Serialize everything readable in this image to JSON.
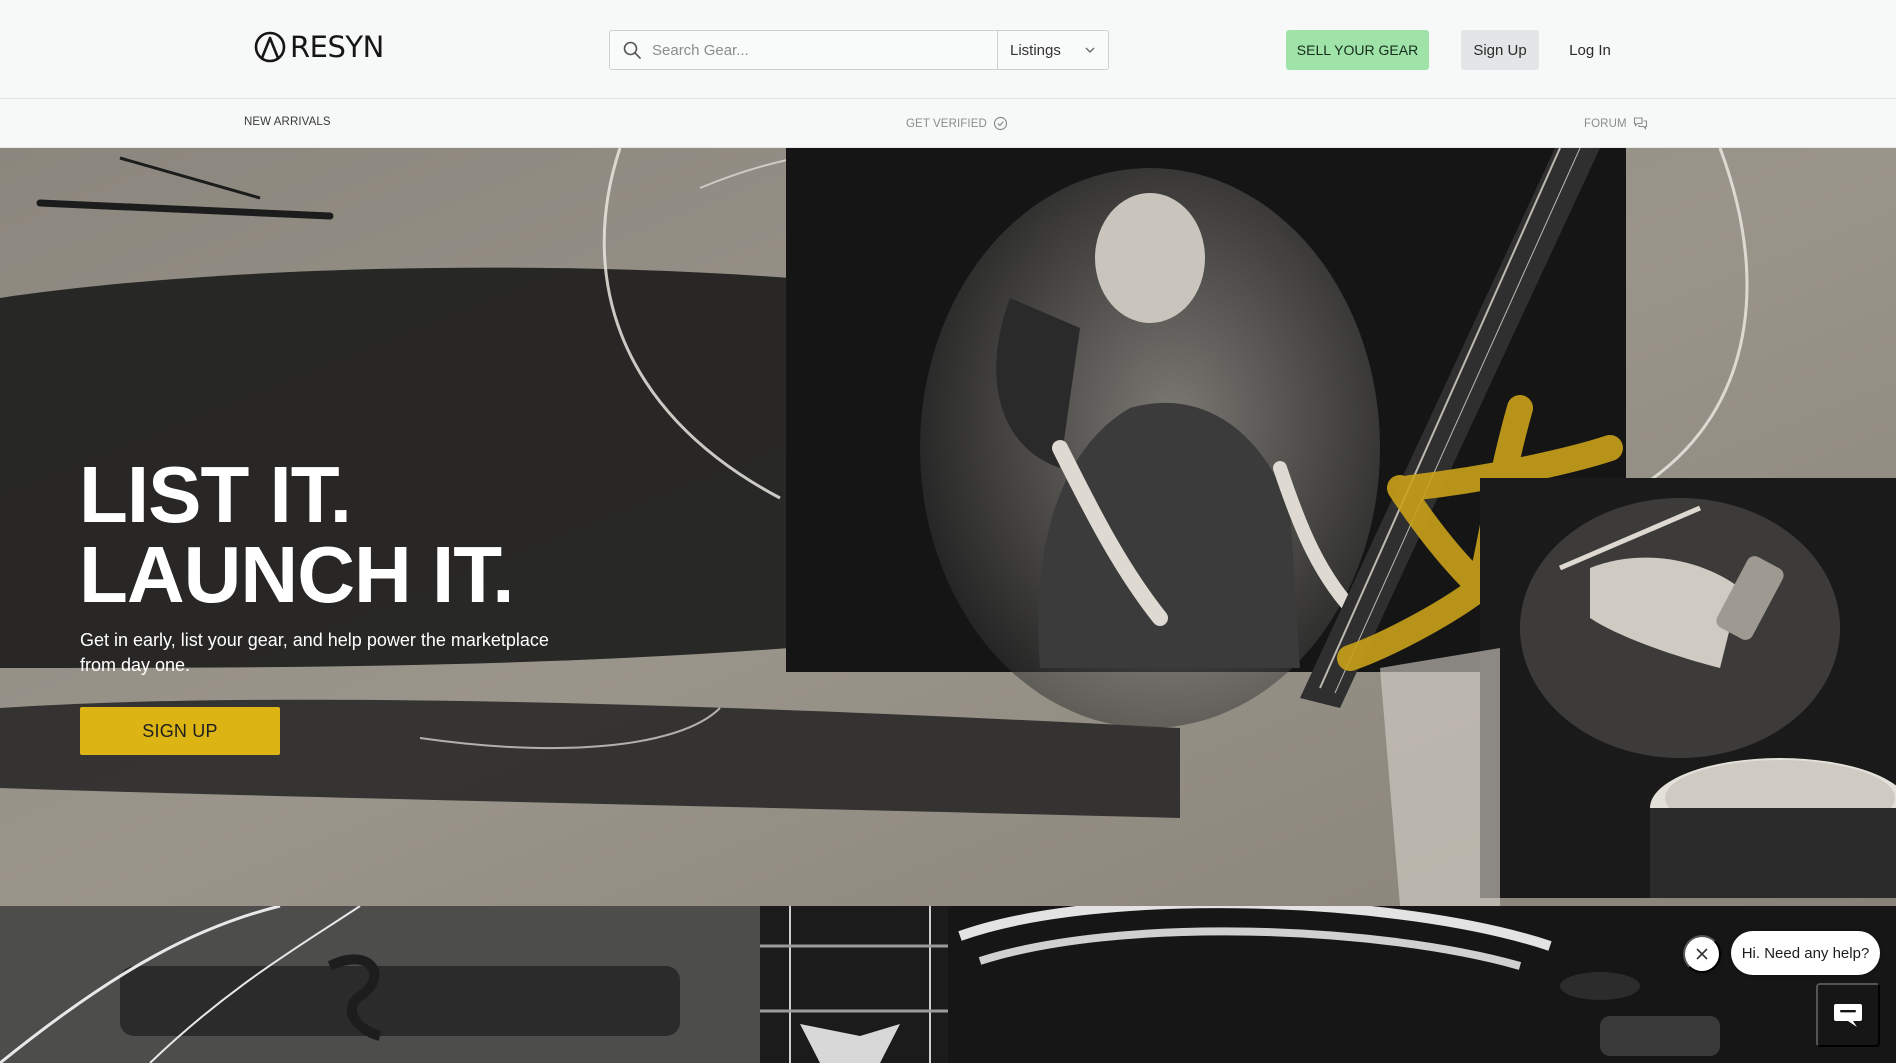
{
  "header": {
    "logo_text": "RESYN",
    "search": {
      "placeholder": "Search Gear...",
      "value": ""
    },
    "listings_select": {
      "selected": "Listings"
    },
    "sell_button": "SELL YOUR GEAR",
    "signup_button": "Sign Up",
    "login_link": "Log In"
  },
  "subnav": {
    "new_arrivals": "NEW ARRIVALS",
    "get_verified": "GET VERIFIED",
    "forum": "FORUM"
  },
  "hero": {
    "title_line1": "LIST IT.",
    "title_line2": "LAUNCH IT.",
    "subtitle": "Get in early, list your gear, and help power the marketplace from day one.",
    "cta": "SIGN UP"
  },
  "help_widget": {
    "message": "Hi. Need any help?"
  },
  "colors": {
    "accent_green": "#9fe3a9",
    "cta_yellow": "#dcb414",
    "hero_bg": "#8e8a82"
  },
  "icons": [
    "logo-mark-icon",
    "search-icon",
    "chevron-down-icon",
    "check-circle-icon",
    "chat-bubbles-icon",
    "close-icon",
    "chat-launcher-icon"
  ]
}
